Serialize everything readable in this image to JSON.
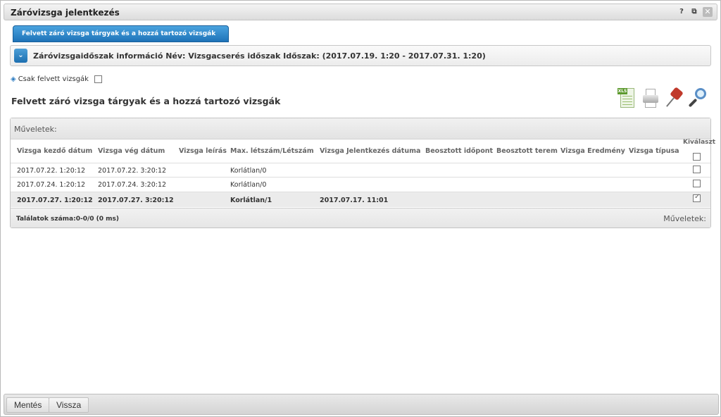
{
  "window": {
    "title": "Záróvizsga jelentkezés",
    "help_icon": "question-icon",
    "popout_icon": "popout-icon",
    "close_icon": "close-icon"
  },
  "tab": {
    "label": "Felvett záró vizsga tárgyak és a hozzá tartozó vizsgák"
  },
  "info": {
    "text": "Záróvizsgaidőszak információ Név: Vizsgacserés időszak Időszak: (2017.07.19. 1:20 - 2017.07.31. 1:20)"
  },
  "filter": {
    "label": "Csak felvett vizsgák",
    "checked": false
  },
  "section": {
    "title": "Felvett záró vizsga tárgyak és a hozzá tartozó vizsgák"
  },
  "toolbar": {
    "xls_label": "XLS",
    "icons": [
      "excel-export-icon",
      "print-icon",
      "pin-icon",
      "search-icon"
    ]
  },
  "grid": {
    "ops_label": "Műveletek:",
    "columns": [
      "Vizsga kezdő dátum",
      "Vizsga vég dátum",
      "Vizsga leírás",
      "Max. létszám/Létszám",
      "Vizsga Jelentkezés dátuma",
      "Beosztott időpont",
      "Beosztott terem",
      "Vizsga Eredmény",
      "Vizsga típusa"
    ],
    "select_header": "Kiválaszt",
    "rows": [
      {
        "start": "2017.07.22. 1:20:12",
        "end": "2017.07.22. 3:20:12",
        "desc": "",
        "capacity": "Korlátlan/0",
        "applied": "",
        "checked": false
      },
      {
        "start": "2017.07.24. 1:20:12",
        "end": "2017.07.24. 3:20:12",
        "desc": "",
        "capacity": "Korlátlan/0",
        "applied": "",
        "checked": false
      },
      {
        "start": "2017.07.27. 1:20:12",
        "end": "2017.07.27. 3:20:12",
        "desc": "",
        "capacity": "Korlátlan/1",
        "applied": "2017.07.17. 11:01",
        "checked": true
      }
    ],
    "count_label": "Találatok száma:0-0/0 (0 ms)",
    "ops_bottom_label": "Műveletek:"
  },
  "buttons": {
    "save": "Mentés",
    "back": "Vissza"
  }
}
